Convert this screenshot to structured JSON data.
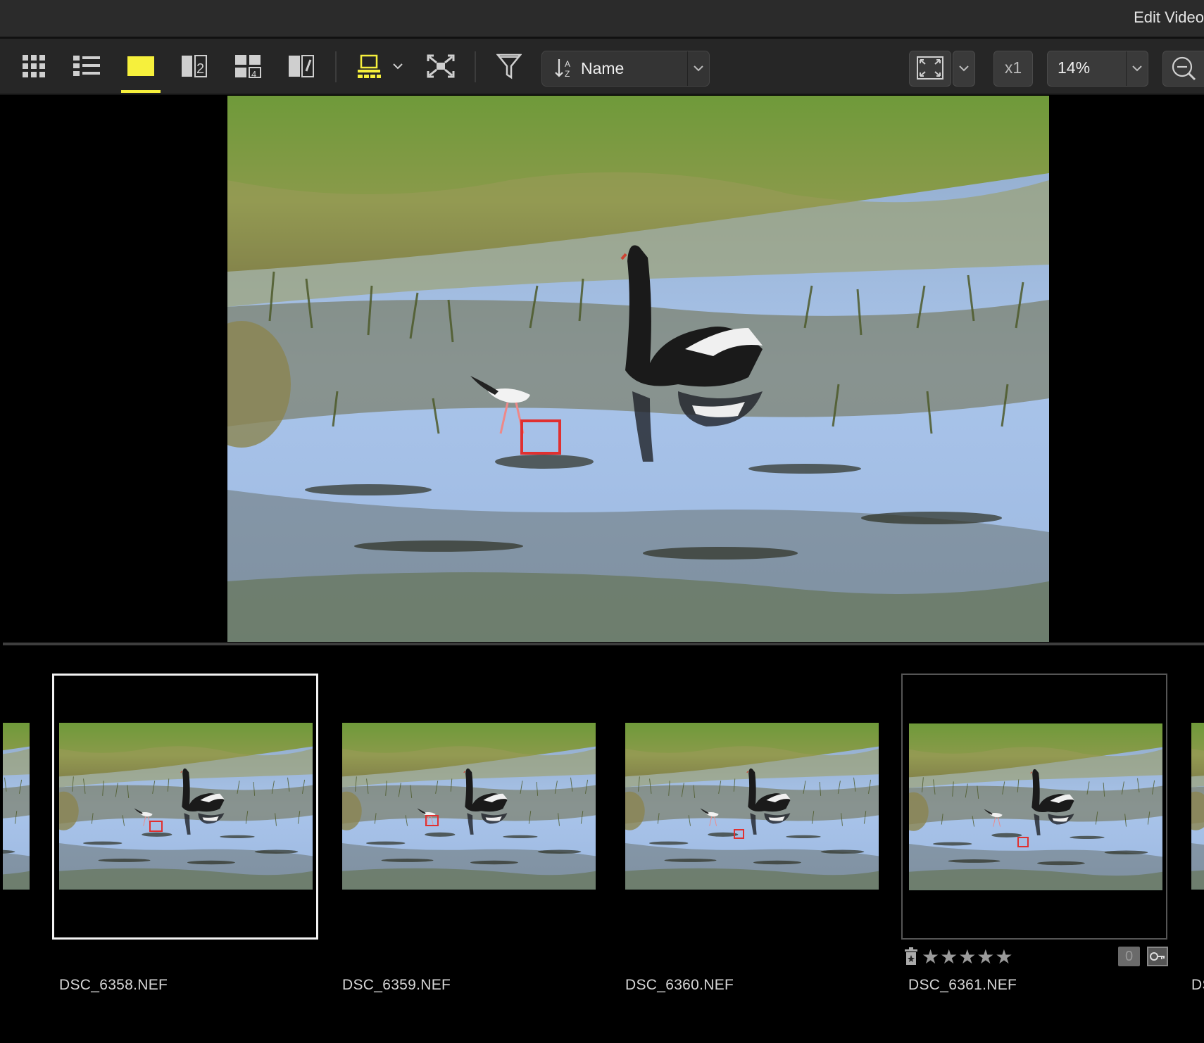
{
  "titlebar": {
    "edit_label": "Edit Video"
  },
  "toolbar": {
    "sort_label": "Name",
    "multiplier_label": "x1",
    "zoom_label": "14%"
  },
  "colors": {
    "accent": "#f6f03c",
    "focus_point": "#e03030"
  },
  "filmstrip": {
    "items": [
      {
        "name": "DSC_6358.NEF"
      },
      {
        "name": "DSC_6359.NEF"
      },
      {
        "name": "DSC_6360.NEF"
      },
      {
        "name": "DSC_6361.NEF"
      },
      {
        "name": "DS"
      }
    ],
    "hover": {
      "count": "0"
    }
  }
}
